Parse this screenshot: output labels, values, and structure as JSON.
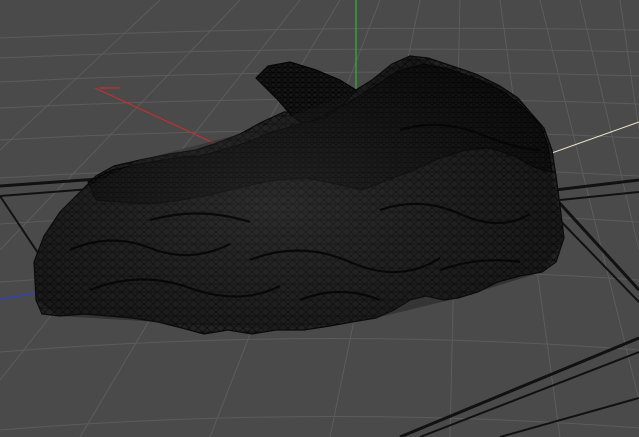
{
  "viewport": {
    "label": "",
    "colors": {
      "background": "#4a4a4a",
      "grid_minor": "#5a5a5a",
      "grid_major": "#111111",
      "mesh_fill": "#202020",
      "mesh_wire": "#0a0a0a",
      "axis_x": "#c03030",
      "axis_y": "#2fb52f",
      "axis_z": "#3040c8",
      "axis_ref": "#e8e8c8"
    },
    "icons": {
      "world_axis": "axis-gizmo-icon"
    },
    "object": {
      "type": "polygon-mesh",
      "display_mode": "wireframe"
    }
  }
}
